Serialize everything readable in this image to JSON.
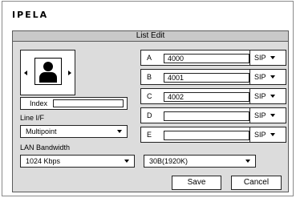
{
  "brand": "IPELA",
  "window": {
    "title": "List Edit"
  },
  "left": {
    "index_label": "Index",
    "index_value": "",
    "line_if_label": "Line I/F",
    "line_if_value": "Multipoint",
    "lan_bandwidth_label": "LAN Bandwidth",
    "lan_bandwidth_value": "1024 Kbps"
  },
  "entries": [
    {
      "letter": "A",
      "number": "4000",
      "protocol": "SIP"
    },
    {
      "letter": "B",
      "number": "4001",
      "protocol": "SIP"
    },
    {
      "letter": "C",
      "number": "4002",
      "protocol": "SIP"
    },
    {
      "letter": "D",
      "number": "",
      "protocol": "SIP"
    },
    {
      "letter": "E",
      "number": "",
      "protocol": "SIP"
    }
  ],
  "resolution_value": "30B(1920K)",
  "buttons": {
    "save": "Save",
    "cancel": "Cancel"
  },
  "icons": [
    "arrow-left-icon",
    "person-icon",
    "arrow-right-icon",
    "chevron-down-icon"
  ]
}
